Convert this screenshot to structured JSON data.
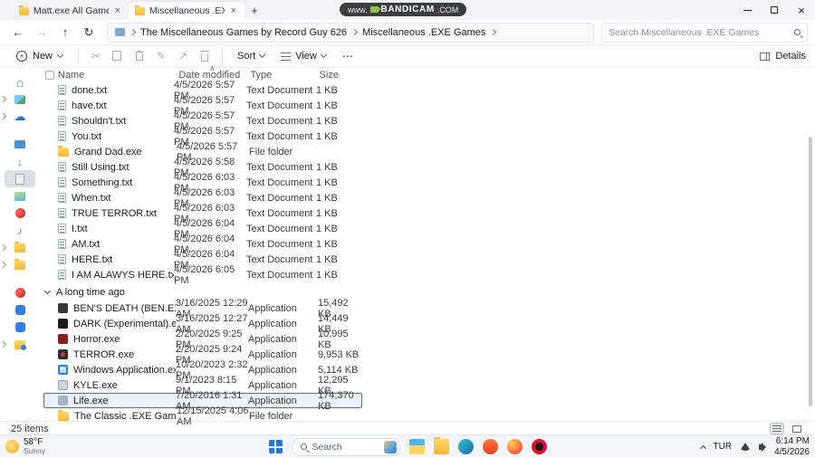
{
  "window": {
    "tabs": [
      {
        "label": "Matt.exe All Games",
        "close": "×"
      },
      {
        "label": "Miscellaneous .EXE Games",
        "close": "×"
      }
    ],
    "new_tab": "+",
    "watermark": {
      "prefix": "www.",
      "brand": "BANDICAM",
      "suffix": ".COM"
    }
  },
  "navbar": {
    "crumb1": "The Miscellaneous Games by Record Guy 626",
    "crumb2": "Miscellaneous .EXE Games",
    "search_placeholder": "Search Miscellaneous .EXE Games"
  },
  "toolbar": {
    "new": "New",
    "sort": "Sort",
    "view": "View",
    "more": "⋯",
    "details": "Details"
  },
  "list": {
    "columns": {
      "name": "Name",
      "modified": "Date modified",
      "type": "Type",
      "size": "Size"
    },
    "group1": {
      "files": [
        {
          "name": "done.txt",
          "modified": "4/5/2026 5:57 PM",
          "type": "Text Document",
          "size": "1 KB",
          "icon": "text"
        },
        {
          "name": "have.txt",
          "modified": "4/5/2026 5:57 PM",
          "type": "Text Document",
          "size": "1 KB",
          "icon": "text"
        },
        {
          "name": "Shouldn't.txt",
          "modified": "4/5/2026 5:57 PM",
          "type": "Text Document",
          "size": "1 KB",
          "icon": "text"
        },
        {
          "name": "You.txt",
          "modified": "4/5/2026 5:57 PM",
          "type": "Text Document",
          "size": "1 KB",
          "icon": "text"
        },
        {
          "name": "Grand Dad.exe",
          "modified": "4/5/2026 5:57 PM",
          "type": "File folder",
          "size": "",
          "icon": "folder"
        },
        {
          "name": "Still Using.txt",
          "modified": "4/5/2026 5:58 PM",
          "type": "Text Document",
          "size": "1 KB",
          "icon": "text"
        },
        {
          "name": "Something.txt",
          "modified": "4/5/2026 6:03 PM",
          "type": "Text Document",
          "size": "1 KB",
          "icon": "text"
        },
        {
          "name": "When.txt",
          "modified": "4/5/2026 6:03 PM",
          "type": "Text Document",
          "size": "1 KB",
          "icon": "text"
        },
        {
          "name": "TRUE TERROR.txt",
          "modified": "4/5/2026 6:03 PM",
          "type": "Text Document",
          "size": "1 KB",
          "icon": "text"
        },
        {
          "name": "I.txt",
          "modified": "4/5/2026 6:04 PM",
          "type": "Text Document",
          "size": "1 KB",
          "icon": "text"
        },
        {
          "name": "AM.txt",
          "modified": "4/5/2026 6:04 PM",
          "type": "Text Document",
          "size": "1 KB",
          "icon": "text"
        },
        {
          "name": "HERE.txt",
          "modified": "4/5/2026 6:04 PM",
          "type": "Text Document",
          "size": "1 KB",
          "icon": "text"
        },
        {
          "name": "I AM ALAWYS HERE.txt",
          "modified": "4/5/2026 6:05 PM",
          "type": "Text Document",
          "size": "1 KB",
          "icon": "text"
        }
      ]
    },
    "group2": {
      "label": "A long time ago",
      "files": [
        {
          "name": "BEN'S DEATH (BEN.EXE Fanmade Cop...",
          "modified": "3/16/2025 12:29 AM",
          "type": "Application",
          "size": "15,492 KB",
          "icon": "app-ben"
        },
        {
          "name": "DARK (Experimental).exe",
          "modified": "3/16/2025 12:27 AM",
          "type": "Application",
          "size": "14,449 KB",
          "icon": "app-dark"
        },
        {
          "name": "Horror.exe",
          "modified": "2/20/2025 9:25 PM",
          "type": "Application",
          "size": "10,995 KB",
          "icon": "app-horror"
        },
        {
          "name": "TERROR.exe",
          "modified": "2/20/2025 9:24 PM",
          "type": "Application",
          "size": "9,953 KB",
          "icon": "app-terror"
        },
        {
          "name": "Windows Application.exe (BEN.EXE Pa...",
          "modified": "10/20/2023 2:32 PM",
          "type": "Application",
          "size": "5,114 KB",
          "icon": "app-win"
        },
        {
          "name": "KYLE.exe",
          "modified": "9/1/2023 8:15 PM",
          "type": "Application",
          "size": "12,295 KB",
          "icon": "app-kyle"
        },
        {
          "name": "Life.exe",
          "modified": "7/20/2016 1:31 AM",
          "type": "Application",
          "size": "174,370 KB",
          "icon": "app-life",
          "selected": true
        },
        {
          "name": "The Classic .EXE Games by Record Guy...",
          "modified": "12/15/2025 4:06 AM",
          "type": "File folder",
          "size": "",
          "icon": "folder"
        }
      ]
    }
  },
  "statusbar": {
    "items": "25 items"
  },
  "sidebar": {
    "items": [
      {
        "icon": "home"
      },
      {
        "icon": "gallery",
        "chev": true
      },
      {
        "icon": "onedrive",
        "chev": true
      },
      {
        "icon": "desktop",
        "gap": true
      },
      {
        "icon": "downloads"
      },
      {
        "icon": "documents",
        "selected": true
      },
      {
        "icon": "pictures"
      },
      {
        "icon": "app-red"
      },
      {
        "icon": "music"
      },
      {
        "icon": "folder",
        "chev": true
      },
      {
        "icon": "folder",
        "chev": true
      },
      {
        "icon": "app-red",
        "gap": true
      },
      {
        "icon": "app-blue"
      },
      {
        "icon": "app-blue"
      },
      {
        "icon": "folder-blue",
        "chev": true
      }
    ]
  },
  "taskbar": {
    "weather": {
      "temp": "58°F",
      "condition": "Sunny"
    },
    "search": "Search",
    "apps": [
      {
        "icon": "file-explorer"
      },
      {
        "icon": "folder"
      },
      {
        "icon": "edge"
      },
      {
        "icon": "brave"
      },
      {
        "icon": "firefox"
      },
      {
        "icon": "opera"
      }
    ],
    "tray": {
      "language": "TUR",
      "time": "6:14 PM",
      "date": "4/5/2026"
    }
  },
  "colors": {
    "accent": "#0067c0",
    "selection_border": "#5f6b78",
    "watermark_bg": "#3d3d3f"
  }
}
